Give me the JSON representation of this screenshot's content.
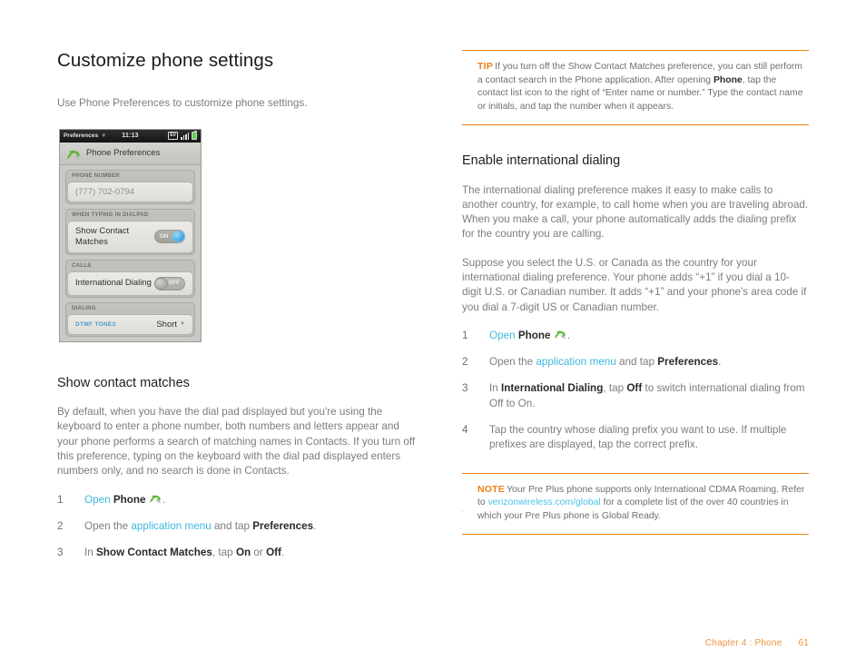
{
  "page_title": "Customize phone settings",
  "left": {
    "lead": "Use Phone Preferences to customize phone settings.",
    "section_title": "Show contact matches",
    "body": "By default, when you have the dial pad displayed but you're using the keyboard to enter a phone number, both numbers and letters appear and your phone performs a search of matching names in Contacts. If you turn off this preference, typing on the keyboard with the dial pad displayed enters numbers only, and no search is done in Contacts.",
    "steps": [
      {
        "num": "1",
        "pre": "",
        "link": "Open",
        "mid": " ",
        "bold": "Phone",
        "post": " ",
        "icon": "phone-handset-icon",
        "tail": "."
      },
      {
        "num": "2",
        "pre": "Open the ",
        "link": "application menu",
        "mid": " and tap ",
        "bold": "Preferences",
        "post": ".",
        "tail": ""
      },
      {
        "num": "3",
        "pre": "In ",
        "bold": "Show Contact Matches",
        "mid": ", tap ",
        "bold2": "On",
        "mid2": " or ",
        "bold3": "Off",
        "post": "."
      }
    ]
  },
  "phone_screenshot": {
    "status": {
      "app_name": "Preferences",
      "caret": "chevron-down-icon",
      "clock": "11:13",
      "network": "EV",
      "signal": "signal-bars-icon",
      "battery": "battery-icon"
    },
    "app_title": "Phone Preferences",
    "app_icon": "phone-handset-icon",
    "groups": [
      {
        "label": "PHONE NUMBER",
        "rows": [
          {
            "type": "value",
            "value": "(777) 702-0794"
          }
        ]
      },
      {
        "label": "WHEN TYPING IN DIALPAD",
        "rows": [
          {
            "type": "toggle",
            "label": "Show Contact Matches",
            "state": "ON"
          }
        ]
      },
      {
        "label": "CALLS",
        "rows": [
          {
            "type": "toggle",
            "label": "International Dialing",
            "state": "OFF"
          }
        ]
      },
      {
        "label": "DIALING",
        "rows": [
          {
            "type": "picker",
            "label": "DTMF TONES",
            "value": "Short"
          }
        ]
      }
    ]
  },
  "right": {
    "tip": {
      "keyword": "TIP",
      "part1": "If you turn off the Show Contact Matches preference, you can still perform a contact search in the Phone application. After opening ",
      "bold": "Phone",
      "part2": ", tap the contact list icon to the right of “Enter name or number.” Type the contact name or initials, and tap the number when it appears."
    },
    "section_title": "Enable international dialing",
    "body1": "The international dialing preference makes it easy to make calls to another country, for example, to call home when you are traveling abroad. When you make a call, your phone automatically adds the dialing prefix for the country you are calling.",
    "body2": "Suppose you select the U.S. or Canada as the country for your international dialing preference. Your phone adds “+1” if you dial a 10-digit U.S. or Canadian number. It adds “+1” and your phone's area code if you dial a 7-digit US or Canadian number.",
    "steps": [
      {
        "num": "1",
        "pre": "",
        "link": "Open",
        "mid": " ",
        "bold": "Phone",
        "post": " ",
        "icon": "phone-handset-icon",
        "tail": "."
      },
      {
        "num": "2",
        "pre": "Open the ",
        "link": "application menu",
        "mid": " and tap ",
        "bold": "Preferences",
        "post": ".",
        "tail": ""
      },
      {
        "num": "3",
        "pre": "In ",
        "bold": "International Dialing",
        "mid": ", tap ",
        "bold2": "Off",
        "post": " to switch international dialing from Off to On."
      },
      {
        "num": "4",
        "pre": "Tap the country whose dialing prefix you want to use. If multiple prefixes are displayed, tap the correct prefix.",
        "post": ""
      }
    ],
    "note": {
      "keyword": "NOTE",
      "part1": "Your Pre Plus phone supports only International CDMA Roaming. Refer to ",
      "link": "verizonwireless.com/global",
      "part2": " for a complete list of the over 40 countries in which your Pre Plus phone is Global Ready."
    },
    "orphan_mark": "."
  },
  "footer": {
    "chapter": "Chapter 4 : Phone",
    "page_number": "61"
  },
  "colors": {
    "accent_orange": "#f07e13",
    "link_blue": "#3fb8e0",
    "footer_orange": "#f0913c",
    "body_gray": "#7d7d80"
  }
}
